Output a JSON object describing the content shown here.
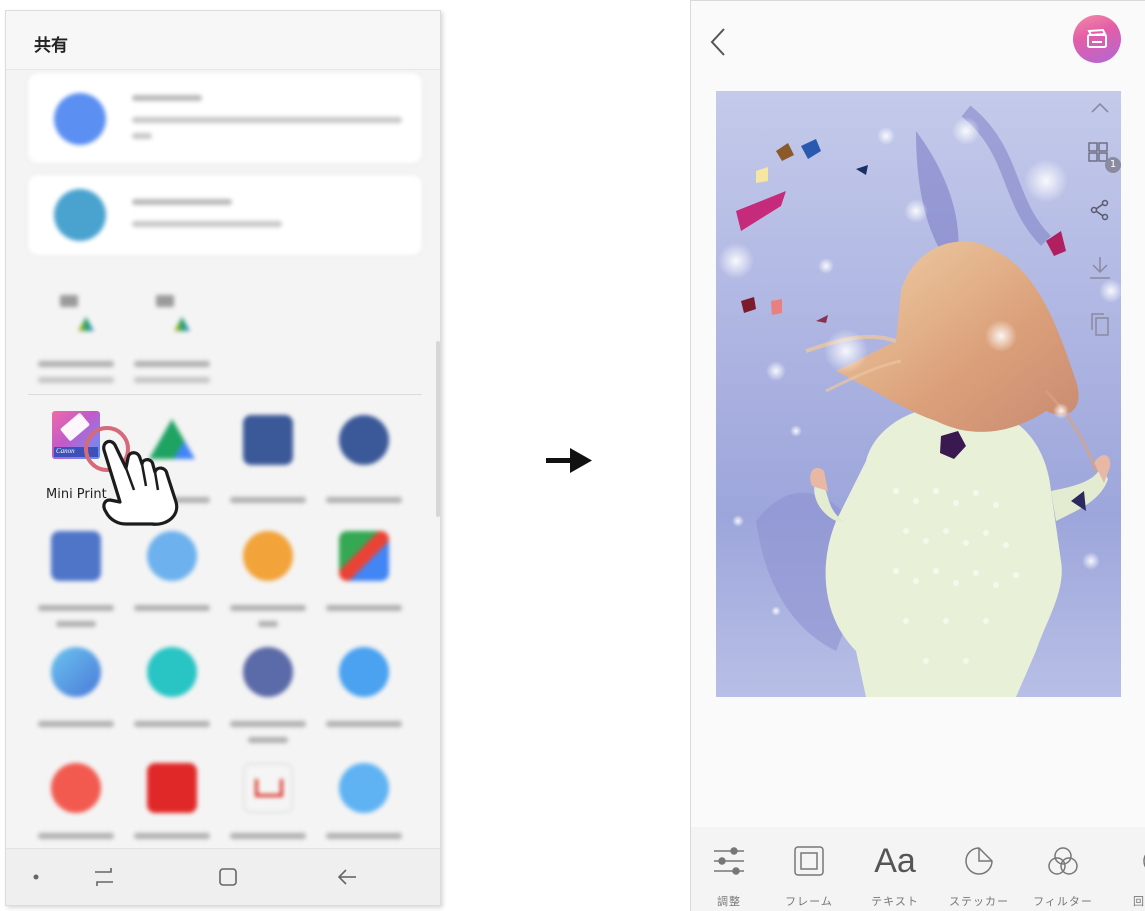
{
  "share_sheet": {
    "title": "共有",
    "highlighted_app": {
      "label": "Mini Print",
      "badge": "Canon"
    }
  },
  "editor": {
    "toolbar": [
      {
        "label": "調整",
        "icon": "sliders-icon"
      },
      {
        "label": "フレーム",
        "icon": "frame-icon"
      },
      {
        "label": "テキスト",
        "icon": "text-icon",
        "glyph": "Aa"
      },
      {
        "label": "ステッカー",
        "icon": "sticker-icon"
      },
      {
        "label": "フィルター",
        "icon": "filter-icon"
      },
      {
        "label": "回",
        "icon": "rotate-icon"
      }
    ],
    "side_tools": [
      {
        "icon": "chevron-up-icon"
      },
      {
        "icon": "tile-icon",
        "badge": "1"
      },
      {
        "icon": "share-icon"
      },
      {
        "icon": "download-icon"
      },
      {
        "icon": "copy-icon"
      }
    ]
  }
}
